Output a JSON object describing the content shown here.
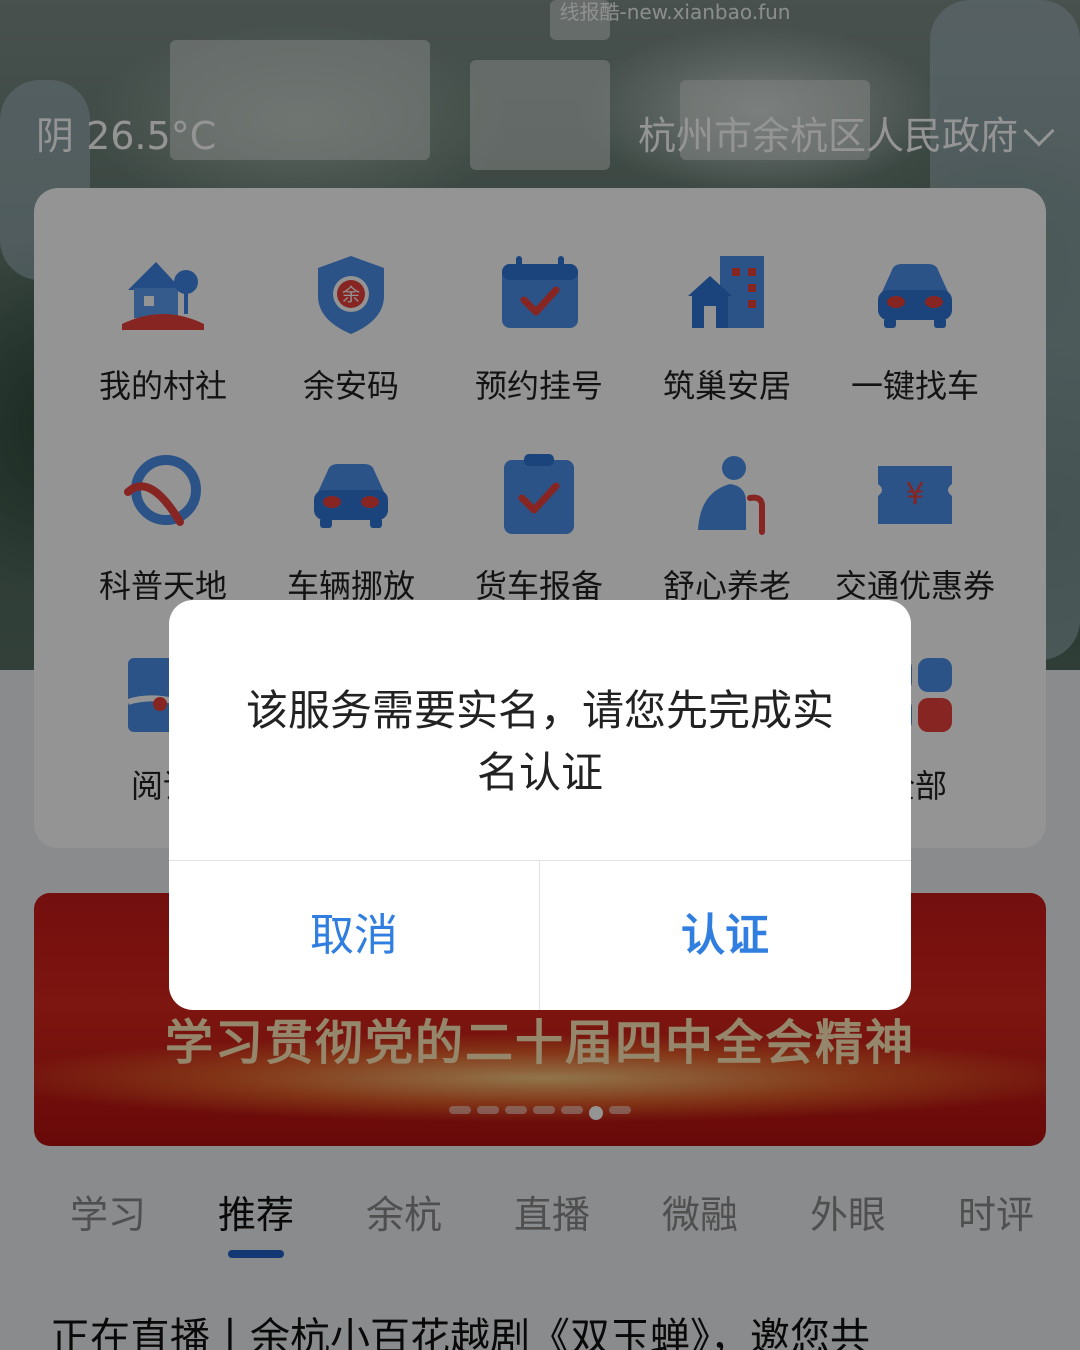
{
  "watermark": "线报酷-new.xianbao.fun",
  "header": {
    "weather": "阴 26.5°C",
    "region": "杭州市余杭区人民政府"
  },
  "services": [
    {
      "label": "我的村社",
      "icon": "village-house-icon"
    },
    {
      "label": "余安码",
      "icon": "shield-code-icon"
    },
    {
      "label": "预约挂号",
      "icon": "calendar-check-icon"
    },
    {
      "label": "筑巢安居",
      "icon": "building-home-icon"
    },
    {
      "label": "一键找车",
      "icon": "car-icon"
    },
    {
      "label": "科普天地",
      "icon": "science-swirl-icon"
    },
    {
      "label": "车辆挪放",
      "icon": "car-icon"
    },
    {
      "label": "货车报备",
      "icon": "clipboard-check-icon"
    },
    {
      "label": "舒心养老",
      "icon": "elderly-person-icon"
    },
    {
      "label": "交通优惠券",
      "icon": "yuan-coupon-icon"
    },
    {
      "label": "阅读",
      "icon": "book-map-icon"
    },
    {
      "label": "全部",
      "icon": "all-apps-icon"
    }
  ],
  "banner": {
    "title": "学习贯彻党的二十届四中全会精神"
  },
  "tabs": [
    "学习",
    "推荐",
    "余杭",
    "直播",
    "微融",
    "外眼",
    "时评"
  ],
  "active_tab": "推荐",
  "headline": "正在直播丨余杭小百花越剧《双玉蝉》，邀您共",
  "dialog": {
    "message": "该服务需要实名，请您先完成实名认证",
    "cancel": "取消",
    "confirm": "认证"
  },
  "colors": {
    "accent": "#2f7ee0",
    "icon_blue": "#2f7ee0",
    "icon_red": "#e8403c",
    "banner_red": "#c71a1a",
    "tab_indicator": "#1f5fc7"
  }
}
